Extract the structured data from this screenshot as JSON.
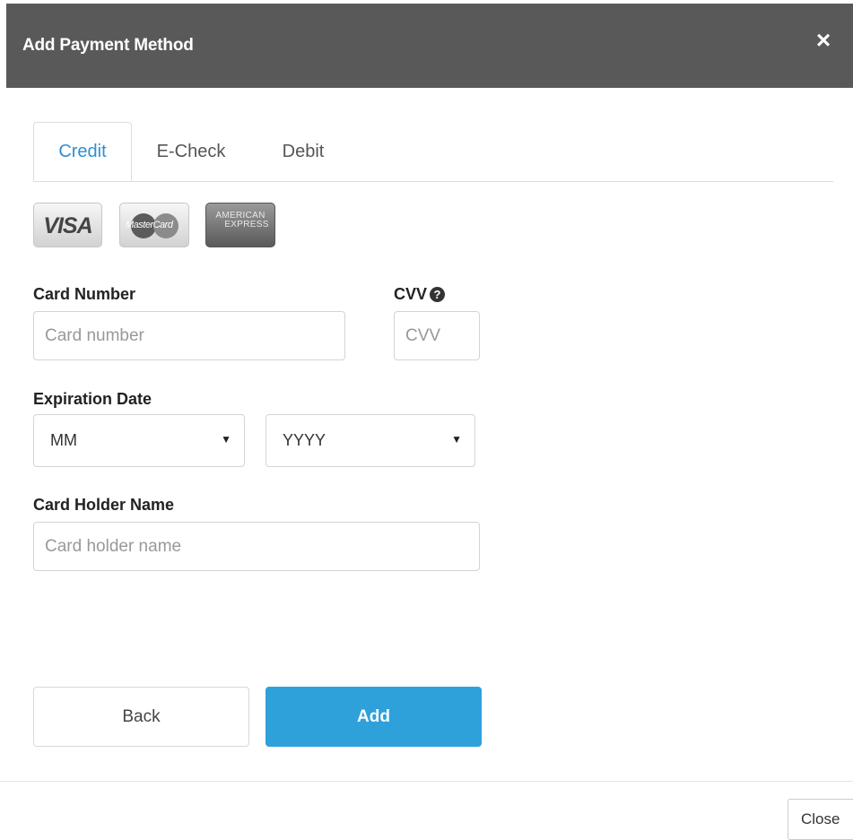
{
  "modal": {
    "title": "Add Payment Method",
    "close_icon": "close-icon"
  },
  "tabs": [
    {
      "label": "Credit",
      "active": true
    },
    {
      "label": "E-Check",
      "active": false
    },
    {
      "label": "Debit",
      "active": false
    }
  ],
  "card_logos": {
    "visa": "VISA",
    "mastercard": "MasterCard",
    "amex_line1": "AMERICAN",
    "amex_line2": "EXPRESS"
  },
  "form": {
    "card_number": {
      "label": "Card Number",
      "placeholder": "Card number",
      "value": ""
    },
    "cvv": {
      "label": "CVV",
      "placeholder": "CVV",
      "value": "",
      "help_icon": "question-circle-icon"
    },
    "expiration": {
      "label": "Expiration Date",
      "month": "MM",
      "year": "YYYY"
    },
    "card_holder": {
      "label": "Card Holder Name",
      "placeholder": "Card holder name",
      "value": ""
    }
  },
  "buttons": {
    "back": "Back",
    "add": "Add",
    "close": "Close"
  },
  "colors": {
    "header_bg": "#595959",
    "active_tab": "#2e8fd0",
    "primary_button": "#2ea1db"
  }
}
